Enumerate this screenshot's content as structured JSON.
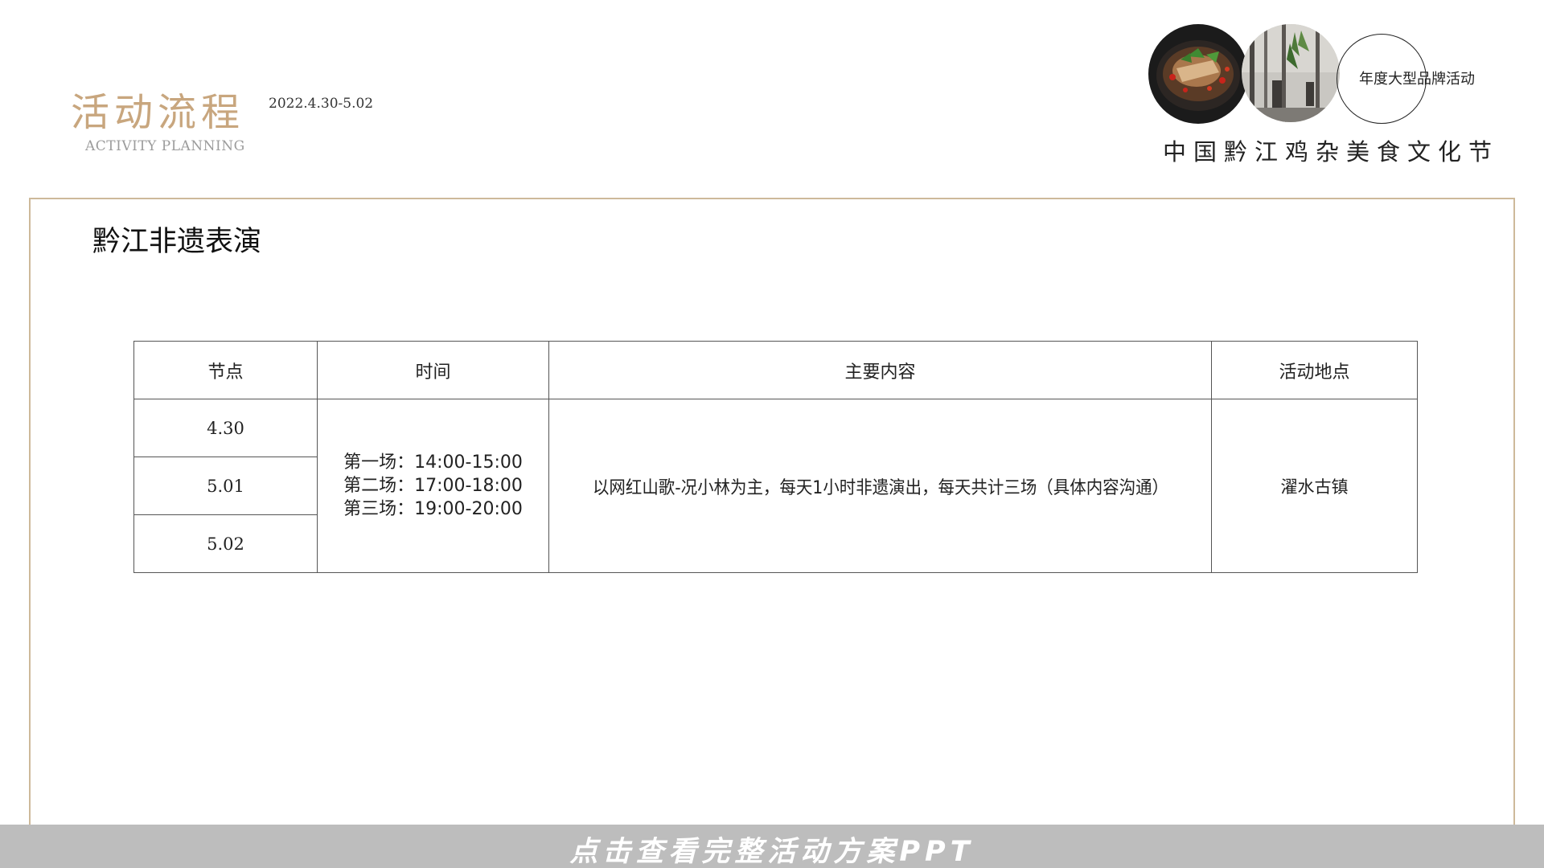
{
  "header": {
    "title_cn": "活动流程",
    "date_range": "2022.4.30-5.02",
    "title_en": "ACTIVITY PLANNING"
  },
  "brand": {
    "tagline": "年度大型品牌活动",
    "festival_name": "中国黔江鸡杂美食文化节"
  },
  "section": {
    "title": "黔江非遗表演"
  },
  "table": {
    "headers": [
      "节点",
      "时间",
      "主要内容",
      "活动地点"
    ],
    "nodes": [
      "4.30",
      "5.01",
      "5.02"
    ],
    "time_slots": [
      "第一场：14:00-15:00",
      "第二场：17:00-18:00",
      "第三场：19:00-20:00"
    ],
    "content": "以网红山歌-况小林为主，每天1小时非遗演出，每天共计三场（具体内容沟通）",
    "location": "濯水古镇"
  },
  "banner": {
    "text": "点击查看完整活动方案PPT"
  },
  "colors": {
    "accent_gold": "#c8a67e",
    "frame_border": "#cdb99a",
    "banner_bg": "#bdbdbd"
  }
}
